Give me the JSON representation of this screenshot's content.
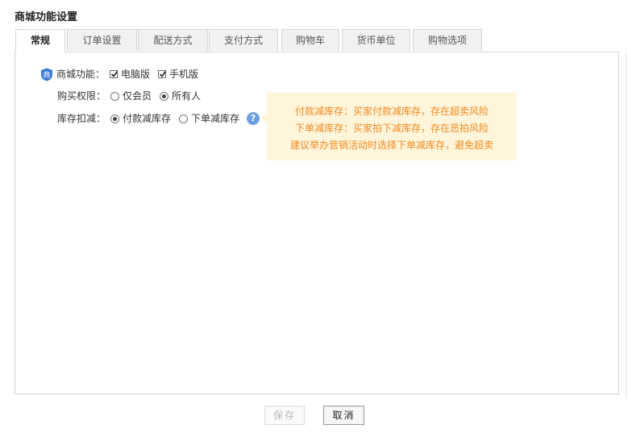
{
  "page": {
    "title": "商城功能设置"
  },
  "tabs": [
    {
      "label": "常规",
      "active": true
    },
    {
      "label": "订单设置"
    },
    {
      "label": "配送方式"
    },
    {
      "label": "支付方式"
    },
    {
      "label": "购物车"
    },
    {
      "label": "货币单位"
    },
    {
      "label": "购物选项"
    }
  ],
  "form": {
    "mall_function": {
      "label": "商城功能：",
      "options": [
        {
          "label": "电脑版",
          "checked": true
        },
        {
          "label": "手机版",
          "checked": true
        }
      ]
    },
    "purchase_permission": {
      "label": "购买权限：",
      "options": [
        {
          "label": "仅会员",
          "selected": false
        },
        {
          "label": "所有人",
          "selected": true
        }
      ]
    },
    "inventory_deduction": {
      "label": "库存扣减：",
      "options": [
        {
          "label": "付款减库存",
          "selected": true
        },
        {
          "label": "下单减库存",
          "selected": false
        }
      ]
    }
  },
  "tooltip": {
    "lines": [
      "付款减库存：买家付款减库存，存在超卖风险",
      "下单减库存：买家拍下减库存，存在恶拍风险",
      "建议举办营销活动时选择下单减库存，避免超卖"
    ]
  },
  "buttons": {
    "save": "保存",
    "cancel": "取消"
  },
  "icons": {
    "shop": "商",
    "help": "?"
  },
  "colors": {
    "tip_bg": "#fff5da",
    "tip_text": "#f08a24",
    "help_icon": "#6f9fe0",
    "shop_badge": "#3a7bd5"
  }
}
